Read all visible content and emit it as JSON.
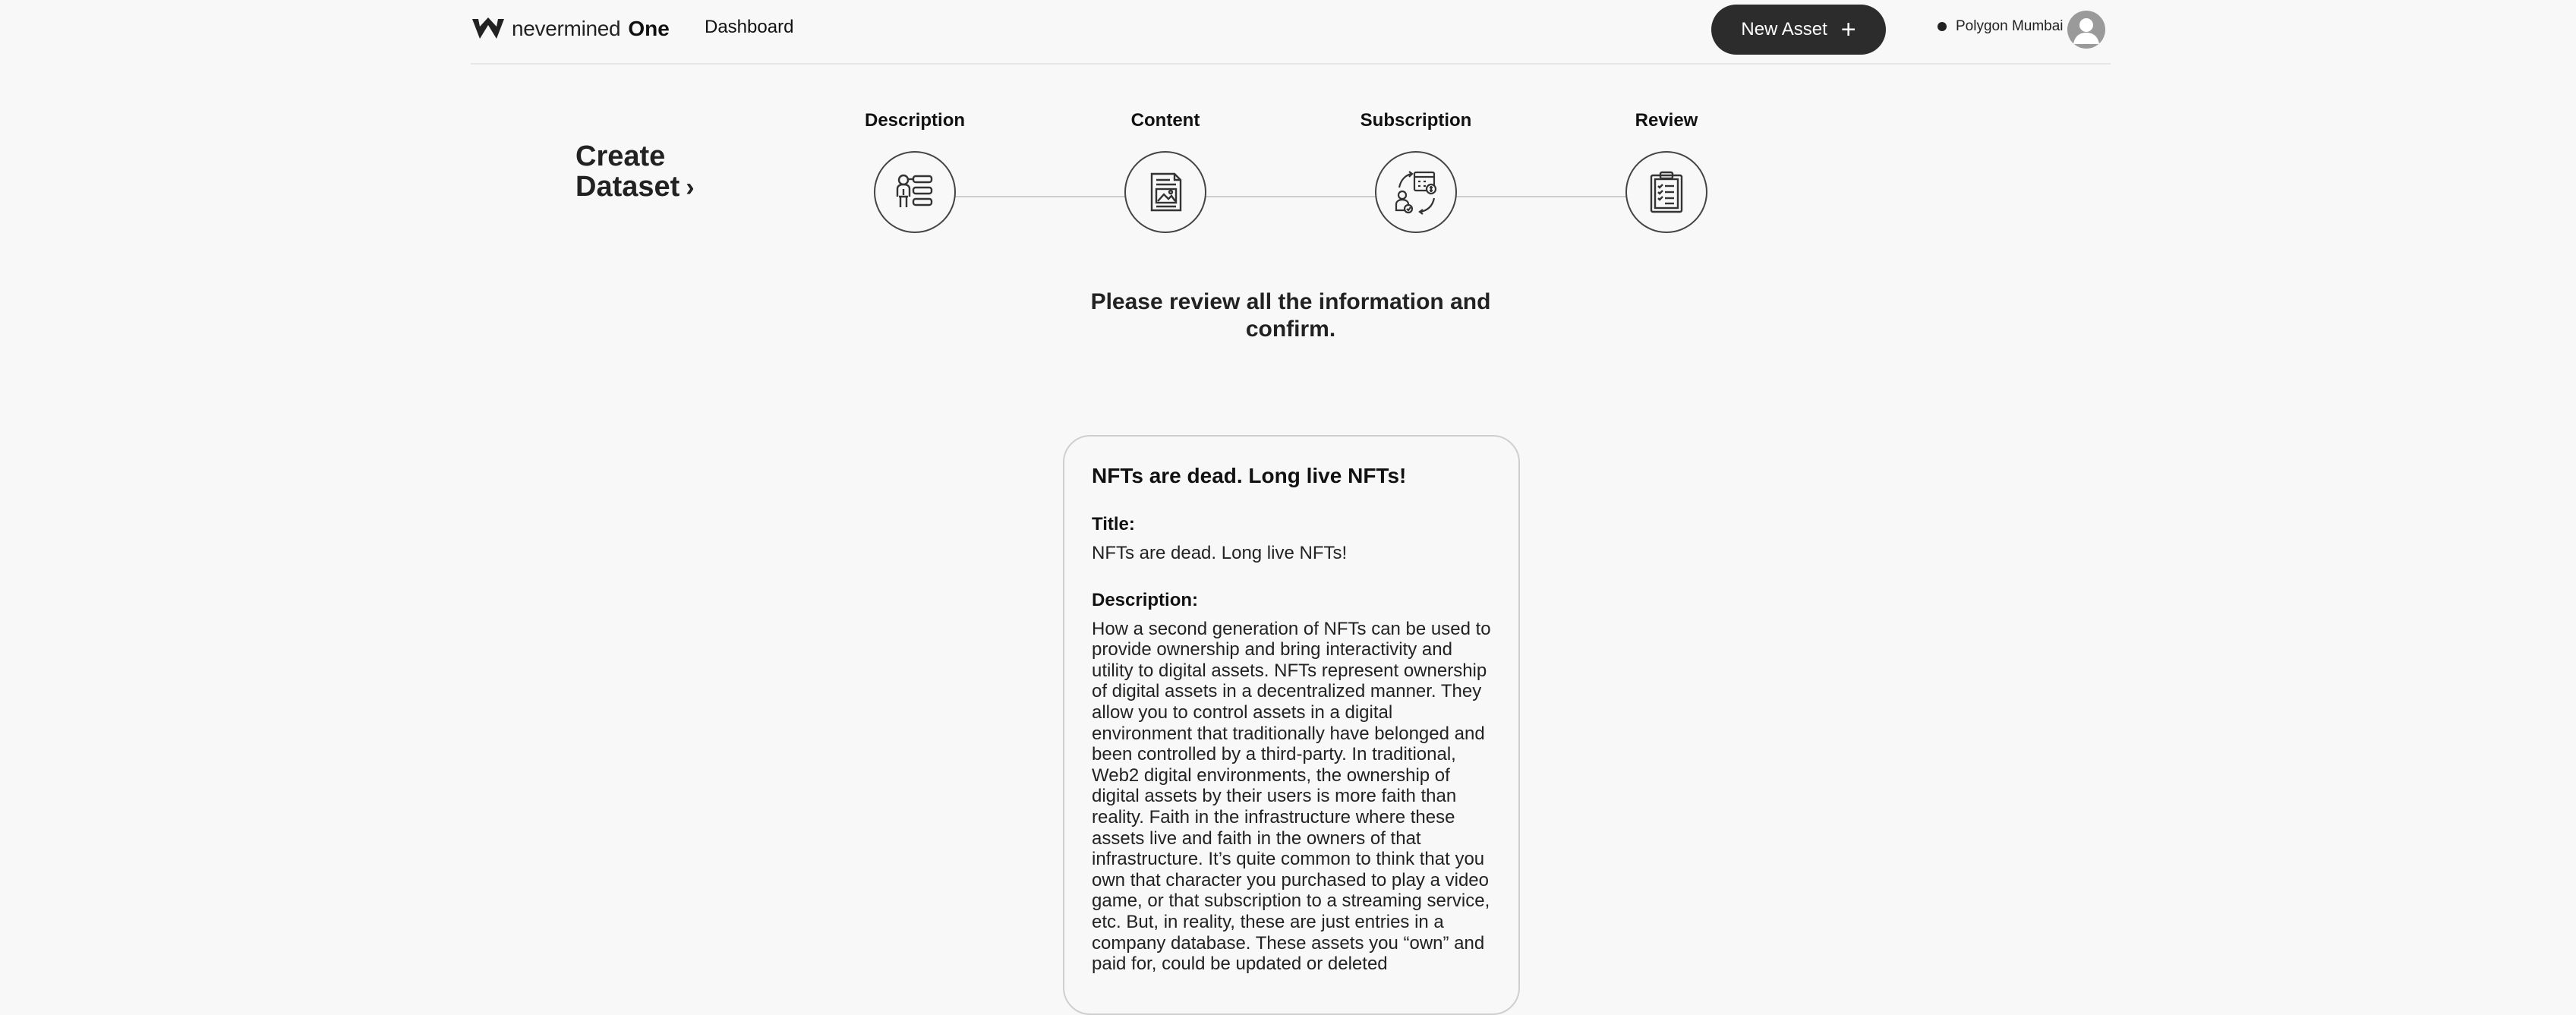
{
  "header": {
    "brand_name": "nevermined",
    "brand_suffix": "One",
    "nav_dashboard": "Dashboard",
    "new_asset_label": "New Asset",
    "new_asset_icon": "+",
    "network_name": "Polygon Mumbai"
  },
  "stepper": {
    "title_line1": "Create",
    "title_line2": "Dataset",
    "chevron": "›",
    "steps": [
      {
        "label": "Description",
        "icon": "description-icon"
      },
      {
        "label": "Content",
        "icon": "content-icon"
      },
      {
        "label": "Subscription",
        "icon": "subscription-icon"
      },
      {
        "label": "Review",
        "icon": "review-icon"
      }
    ]
  },
  "review": {
    "prompt": "Please review all the information and confirm."
  },
  "card": {
    "heading": "NFTs are dead. Long live NFTs!",
    "title_label": "Title:",
    "title_value": "NFTs are dead. Long live NFTs!",
    "description_label": "Description:",
    "description_value": "How a second generation of NFTs can be used to provide ownership and bring interactivity and utility to digital assets. NFTs represent ownership of digital assets in a decentralized manner. They allow you to control assets in a digital environment that traditionally have belonged and been controlled by a third-party. In traditional, Web2 digital environments, the ownership of digital assets by their users is more faith than reality. Faith in the infrastructure where these assets live and faith in the owners of that infrastructure. It’s quite common to think that you own that character you purchased to play a video game, or that subscription to a streaming service, etc. But, in reality, these are just entries in a company database. These assets you “own” and paid for, could be updated or deleted"
  }
}
